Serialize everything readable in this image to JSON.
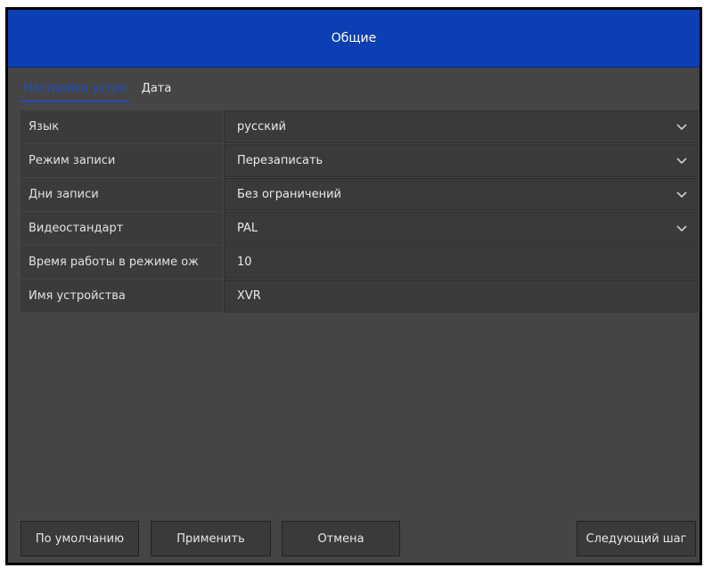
{
  "window": {
    "title": "Общие"
  },
  "tabs": [
    {
      "label": "Настройка устро",
      "active": true
    },
    {
      "label": "Дата",
      "active": false
    }
  ],
  "settings": [
    {
      "label": "Язык",
      "value": "русский",
      "dropdown": true
    },
    {
      "label": "Режим записи",
      "value": "Перезаписать",
      "dropdown": true
    },
    {
      "label": "Дни записи",
      "value": "Без ограничений",
      "dropdown": true
    },
    {
      "label": "Видеостандарт",
      "value": "PAL",
      "dropdown": true
    },
    {
      "label": "Время работы в режиме ож",
      "value": "10",
      "dropdown": false
    },
    {
      "label": "Имя устройства",
      "value": "XVR",
      "dropdown": false
    }
  ],
  "buttons": {
    "default": "По умолчанию",
    "apply": "Применить",
    "cancel": "Отмена",
    "next": "Следующий шаг"
  },
  "icons": {
    "dropdown": "chevron-down-icon"
  },
  "colors": {
    "titlebar": "#0b3fb3",
    "active_tab": "#1f4fc0",
    "panel": "#454545"
  }
}
